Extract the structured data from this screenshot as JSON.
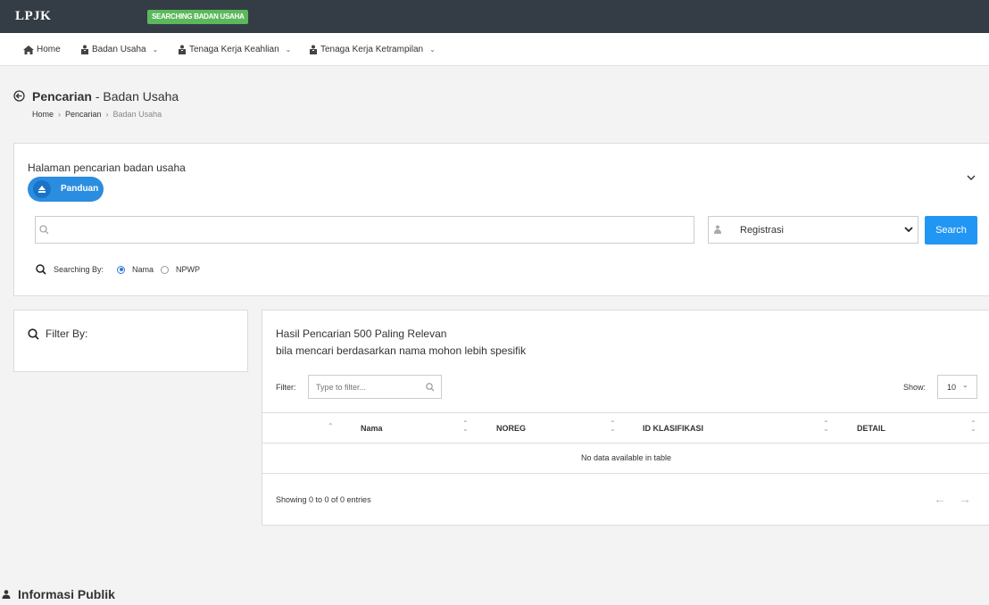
{
  "app": {
    "logo": "LPJK",
    "status_badge": "SEARCHING BADAN USAHA"
  },
  "nav": {
    "items": [
      {
        "label": "Home",
        "icon": "home-icon"
      },
      {
        "label": "Badan Usaha",
        "icon": "briefcase-user-icon",
        "has_dropdown": true
      },
      {
        "label": "Tenaga Kerja Keahlian",
        "icon": "briefcase-user-icon",
        "has_dropdown": true
      },
      {
        "label": "Tenaga Kerja Ketrampilan",
        "icon": "briefcase-user-icon",
        "has_dropdown": true
      }
    ]
  },
  "page": {
    "title_bold": "Pencarian",
    "title_rest": " - Badan Usaha",
    "breadcrumb": [
      "Home",
      "Pencarian",
      "Badan Usaha"
    ]
  },
  "search": {
    "intro": "Halaman pencarian badan usaha",
    "guide_button": "Panduan",
    "query_value": "",
    "query_placeholder": "",
    "type_select": "Registrasi",
    "button": "Search",
    "searching_by_label": "Searching By:",
    "options": [
      {
        "label": "Nama",
        "selected": true
      },
      {
        "label": "NPWP",
        "selected": false
      }
    ]
  },
  "filter": {
    "title": "Filter By:"
  },
  "results": {
    "title": "Hasil Pencarian 500 Paling Relevan",
    "subtitle": "bila mencari berdasarkan nama mohon lebih spesifik",
    "filter_label": "Filter:",
    "filter_placeholder": "Type to filter...",
    "show_label": "Show:",
    "show_value": "10",
    "columns": [
      "",
      "Nama",
      "NOREG",
      "ID KLASIFIKASI",
      "DETAIL"
    ],
    "rows": [],
    "empty_message": "No data available in table",
    "info": "Showing 0 to 0 of 0 entries",
    "prev": "←",
    "next": "→"
  },
  "footer": {
    "title": "Informasi Publik"
  },
  "colors": {
    "topbar": "#343d45",
    "badge": "#5cb85c",
    "primary": "#2196f3",
    "guide": "#2b8de0"
  }
}
